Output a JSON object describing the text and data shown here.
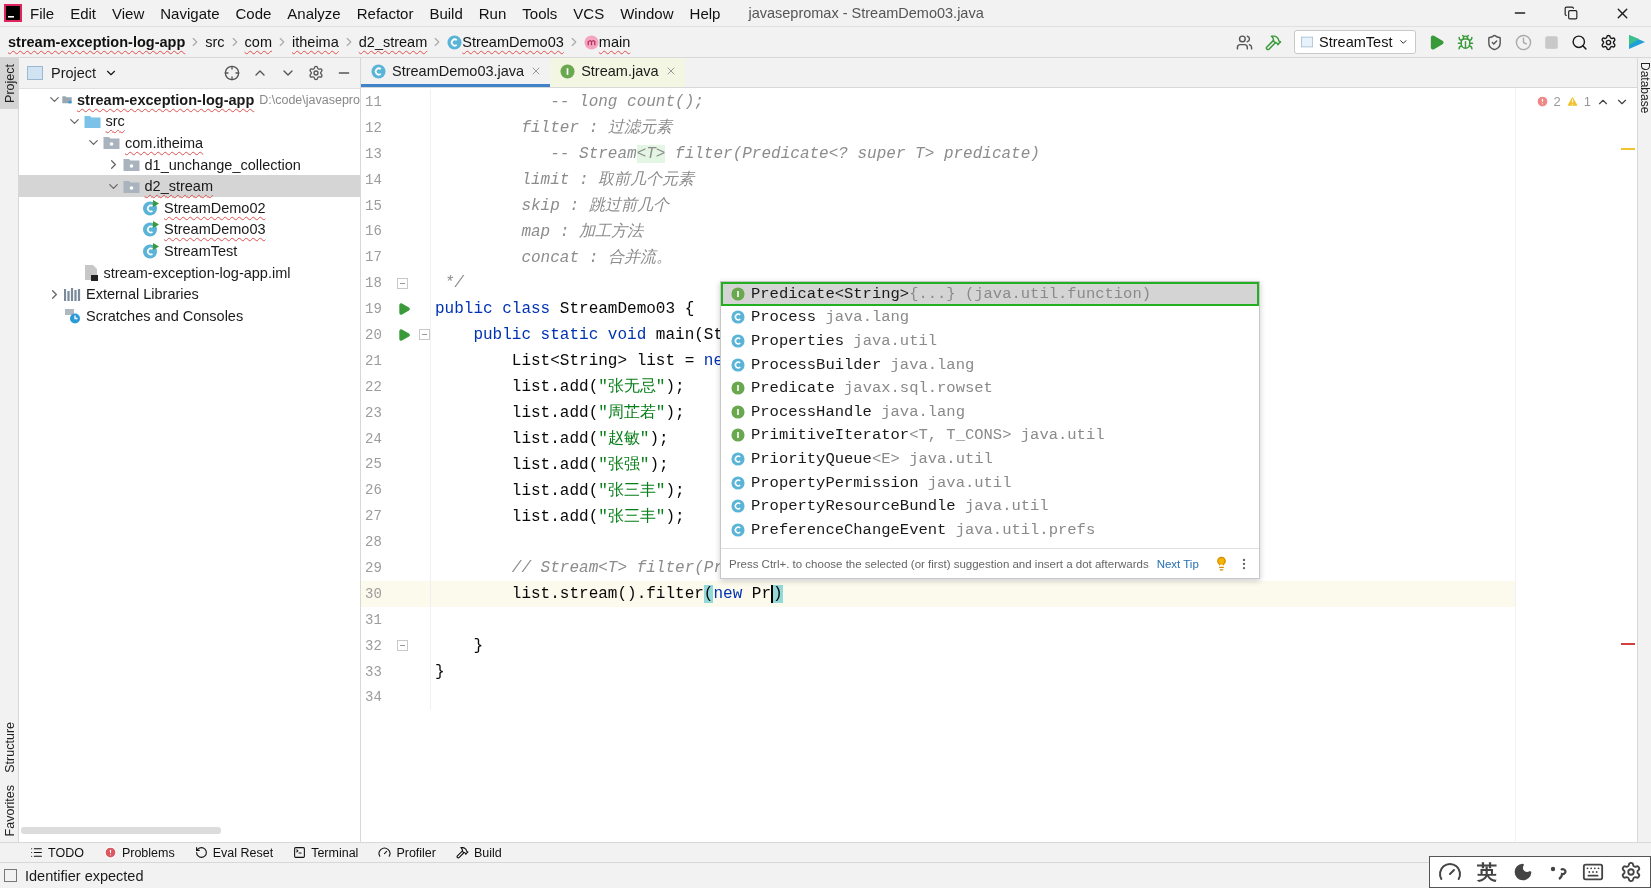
{
  "window": {
    "title": "javasepromax - StreamDemo03.java"
  },
  "menu": [
    "File",
    "Edit",
    "View",
    "Navigate",
    "Code",
    "Analyze",
    "Refactor",
    "Build",
    "Run",
    "Tools",
    "VCS",
    "Window",
    "Help"
  ],
  "breadcrumb": [
    {
      "label": "stream-exception-log-app",
      "kind": "project",
      "squiggle": true
    },
    {
      "label": "src",
      "kind": "folder",
      "squiggle": false
    },
    {
      "label": "com",
      "kind": "folder",
      "squiggle": true
    },
    {
      "label": "itheima",
      "kind": "folder",
      "squiggle": true
    },
    {
      "label": "d2_stream",
      "kind": "folder",
      "squiggle": true
    },
    {
      "label": "StreamDemo03",
      "kind": "class",
      "squiggle": true
    },
    {
      "label": "main",
      "kind": "method",
      "squiggle": true
    }
  ],
  "run_config": {
    "label": "StreamTest"
  },
  "side_tabs": {
    "left_top": {
      "label": "Project",
      "selected": true
    },
    "left_bottom": [
      {
        "label": "Structure",
        "selected": false
      },
      {
        "label": "Favorites",
        "selected": false
      }
    ],
    "right": {
      "label": "Database",
      "selected": false
    }
  },
  "project_panel": {
    "title": "Project",
    "tree": [
      {
        "label": "stream-exception-log-app",
        "path": "D:\\code\\javasepro",
        "kind": "module",
        "expanded": true,
        "selected": false,
        "squiggle": true,
        "children": [
          {
            "label": "src",
            "kind": "source",
            "expanded": true,
            "selected": false,
            "squiggle": true,
            "children": [
              {
                "label": "com.itheima",
                "kind": "package",
                "expanded": true,
                "selected": false,
                "squiggle": true,
                "children": [
                  {
                    "label": "d1_unchange_collection",
                    "kind": "package",
                    "expanded": false,
                    "selected": false,
                    "squiggle": false
                  },
                  {
                    "label": "d2_stream",
                    "kind": "package",
                    "expanded": true,
                    "selected": true,
                    "squiggle": true,
                    "children": [
                      {
                        "label": "StreamDemo02",
                        "kind": "class",
                        "selected": false,
                        "squiggle": true
                      },
                      {
                        "label": "StreamDemo03",
                        "kind": "class",
                        "selected": false,
                        "squiggle": true
                      },
                      {
                        "label": "StreamTest",
                        "kind": "class",
                        "selected": false,
                        "squiggle": false
                      }
                    ]
                  }
                ]
              }
            ]
          },
          {
            "label": "stream-exception-log-app.iml",
            "kind": "file",
            "selected": false,
            "squiggle": false
          }
        ]
      },
      {
        "label": "External Libraries",
        "kind": "libraries",
        "expanded": false,
        "selected": false,
        "squiggle": false
      },
      {
        "label": "Scratches and Consoles",
        "kind": "scratches",
        "selected": false,
        "squiggle": false
      }
    ]
  },
  "tabs": [
    {
      "label": "StreamDemo03.java",
      "kind": "class",
      "selected": true
    },
    {
      "label": "Stream.java",
      "kind": "interface",
      "selected": false
    }
  ],
  "inspections": {
    "errors": "2",
    "warnings": "1"
  },
  "code": [
    {
      "number": "11",
      "current": false,
      "tokens": [
        {
          "kind": "comment",
          "text": "            -- long count();"
        }
      ]
    },
    {
      "number": "12",
      "current": false,
      "tokens": [
        {
          "kind": "comment",
          "text": "         filter : 过滤元素"
        }
      ]
    },
    {
      "number": "13",
      "current": false,
      "tokens": [
        {
          "kind": "comment",
          "text": "            -- Stream"
        },
        {
          "kind": "tag",
          "text": "<T>"
        },
        {
          "kind": "comment",
          "text": " filter(Predicate<? super T> "
        },
        {
          "kind": "param",
          "text": "predicate"
        },
        {
          "kind": "comment",
          "text": ")"
        }
      ]
    },
    {
      "number": "14",
      "current": false,
      "tokens": [
        {
          "kind": "comment",
          "text": "         limit : 取前几个元素"
        }
      ]
    },
    {
      "number": "15",
      "current": false,
      "tokens": [
        {
          "kind": "comment",
          "text": "         skip : 跳过前几个"
        }
      ]
    },
    {
      "number": "16",
      "current": false,
      "tokens": [
        {
          "kind": "comment",
          "text": "         map : 加工方法"
        }
      ]
    },
    {
      "number": "17",
      "current": false,
      "tokens": [
        {
          "kind": "comment",
          "text": "         concat : 合并流。"
        }
      ]
    },
    {
      "number": "18",
      "current": false,
      "run": false,
      "fold": true,
      "tokens": [
        {
          "kind": "comment",
          "text": " */"
        }
      ]
    },
    {
      "number": "19",
      "current": false,
      "run": true,
      "fold": false,
      "tokens": [
        {
          "kind": "keyword",
          "text": "public class"
        },
        {
          "kind": "plain",
          "text": " StreamDemo03 {"
        }
      ]
    },
    {
      "number": "20",
      "current": false,
      "run": true,
      "fold": true,
      "tokens": [
        {
          "kind": "keyword",
          "text": "    public static void"
        },
        {
          "kind": "plain",
          "text": " main(St"
        }
      ]
    },
    {
      "number": "21",
      "current": false,
      "tokens": [
        {
          "kind": "plain",
          "text": "        List<String> list = "
        },
        {
          "kind": "keyword",
          "text": "ne"
        }
      ]
    },
    {
      "number": "22",
      "current": false,
      "tokens": [
        {
          "kind": "plain",
          "text": "        list.add("
        },
        {
          "kind": "string",
          "text": "\"张无忌\""
        },
        {
          "kind": "plain",
          "text": ");"
        }
      ]
    },
    {
      "number": "23",
      "current": false,
      "tokens": [
        {
          "kind": "plain",
          "text": "        list.add("
        },
        {
          "kind": "string",
          "text": "\"周芷若\""
        },
        {
          "kind": "plain",
          "text": ");"
        }
      ]
    },
    {
      "number": "24",
      "current": false,
      "tokens": [
        {
          "kind": "plain",
          "text": "        list.add("
        },
        {
          "kind": "string",
          "text": "\"赵敏\""
        },
        {
          "kind": "plain",
          "text": ");"
        }
      ]
    },
    {
      "number": "25",
      "current": false,
      "tokens": [
        {
          "kind": "plain",
          "text": "        list.add("
        },
        {
          "kind": "string",
          "text": "\"张强\""
        },
        {
          "kind": "plain",
          "text": ");"
        }
      ]
    },
    {
      "number": "26",
      "current": false,
      "tokens": [
        {
          "kind": "plain",
          "text": "        list.add("
        },
        {
          "kind": "string",
          "text": "\"张三丰\""
        },
        {
          "kind": "plain",
          "text": ");"
        }
      ]
    },
    {
      "number": "27",
      "current": false,
      "tokens": [
        {
          "kind": "plain",
          "text": "        list.add("
        },
        {
          "kind": "string",
          "text": "\"张三丰\""
        },
        {
          "kind": "plain",
          "text": ");"
        }
      ]
    },
    {
      "number": "28",
      "current": false
    },
    {
      "number": "29",
      "current": false,
      "tokens": [
        {
          "kind": "comment",
          "text": "        // Stream<T> filter(Pr"
        }
      ]
    },
    {
      "number": "30",
      "current": true,
      "tokens": [
        {
          "kind": "plain",
          "text": "        list.stream().filter"
        },
        {
          "kind": "brace",
          "text": "("
        },
        {
          "kind": "keyword",
          "text": "new"
        },
        {
          "kind": "plain",
          "text": " Pr"
        },
        {
          "kind": "brace",
          "text": ")",
          "caret": true
        }
      ]
    },
    {
      "number": "31",
      "current": false
    },
    {
      "number": "32",
      "current": false,
      "run": false,
      "fold": true,
      "tokens": [
        {
          "kind": "plain",
          "text": "    }"
        }
      ]
    },
    {
      "number": "33",
      "current": false,
      "tokens": [
        {
          "kind": "plain",
          "text": "}"
        }
      ]
    },
    {
      "number": "34",
      "current": false
    }
  ],
  "completion": {
    "items": [
      {
        "name": "Predicate<String>",
        "suffix": "{...}",
        "package": "(java.util.function)",
        "kind": "interface",
        "selected": true
      },
      {
        "name": "Process",
        "package": "java.lang",
        "kind": "class",
        "selected": false
      },
      {
        "name": "Properties",
        "package": "java.util",
        "kind": "class",
        "selected": false
      },
      {
        "name": "ProcessBuilder",
        "package": "java.lang",
        "kind": "class",
        "selected": false
      },
      {
        "name": "Predicate",
        "package": "javax.sql.rowset",
        "kind": "interface",
        "selected": false
      },
      {
        "name": "ProcessHandle",
        "package": "java.lang",
        "kind": "interface",
        "selected": false
      },
      {
        "name": "PrimitiveIterator",
        "suffix": "<T, T_CONS>",
        "package": "java.util",
        "kind": "interface",
        "selected": false
      },
      {
        "name": "PriorityQueue",
        "suffix": "<E>",
        "package": "java.util",
        "kind": "class",
        "selected": false
      },
      {
        "name": "PropertyPermission",
        "package": "java.util",
        "kind": "class",
        "selected": false
      },
      {
        "name": "PropertyResourceBundle",
        "package": "java.util",
        "kind": "class",
        "selected": false
      },
      {
        "name": "PreferenceChangeEvent",
        "package": "java.util.prefs",
        "kind": "class",
        "selected": false
      }
    ],
    "hint": "Press Ctrl+. to choose the selected (or first) suggestion and insert a dot afterwards",
    "link": "Next Tip"
  },
  "tool_windows": [
    {
      "label": "TODO",
      "kind": "todo"
    },
    {
      "label": "Problems",
      "kind": "problems"
    },
    {
      "label": "Eval Reset",
      "kind": "reset"
    },
    {
      "label": "Terminal",
      "kind": "terminal"
    },
    {
      "label": "Profiler",
      "kind": "profiler"
    },
    {
      "label": "Build",
      "kind": "build"
    }
  ],
  "status": {
    "message": "Identifier expected"
  },
  "ime": {
    "mode": "英"
  }
}
